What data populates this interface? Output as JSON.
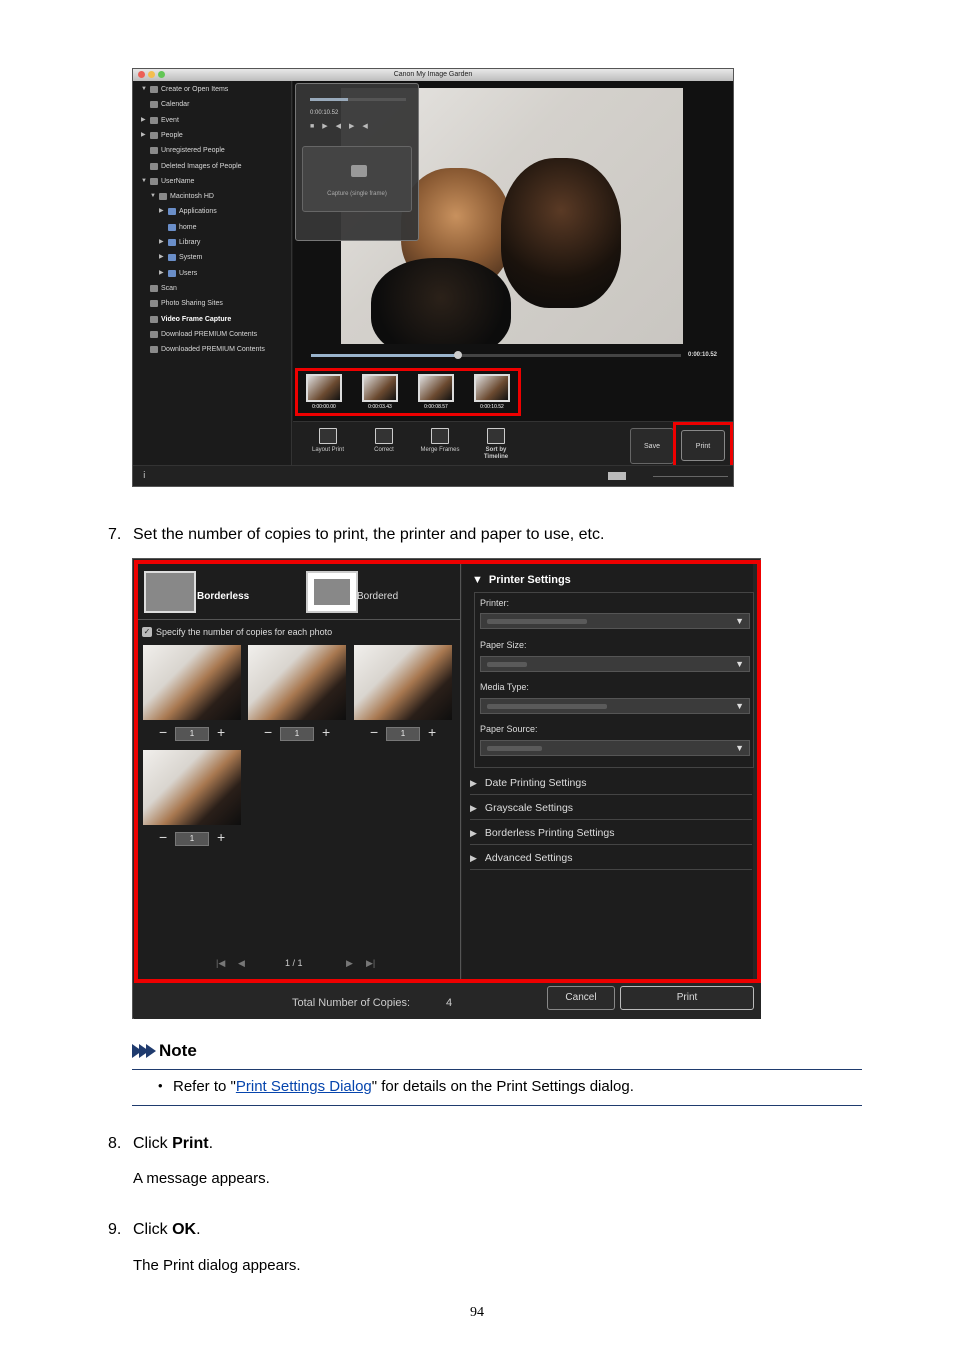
{
  "screenshot1": {
    "window_title": "Canon My Image Garden",
    "tree": [
      {
        "label": "Create or Open Items",
        "indent": 0,
        "arrow": "▼"
      },
      {
        "label": "Calendar",
        "indent": 0,
        "arrow": ""
      },
      {
        "label": "Event",
        "indent": 0,
        "arrow": "▶"
      },
      {
        "label": "People",
        "indent": 0,
        "arrow": "▶"
      },
      {
        "label": "Unregistered People",
        "indent": 0,
        "arrow": ""
      },
      {
        "label": "Deleted Images of People",
        "indent": 0,
        "arrow": ""
      },
      {
        "label": "UserName",
        "indent": 0,
        "arrow": "▼"
      },
      {
        "label": "Macintosh HD",
        "indent": 1,
        "arrow": "▼"
      },
      {
        "label": "Applications",
        "indent": 2,
        "arrow": "▶"
      },
      {
        "label": "home",
        "indent": 2,
        "arrow": ""
      },
      {
        "label": "Library",
        "indent": 2,
        "arrow": "▶"
      },
      {
        "label": "System",
        "indent": 2,
        "arrow": "▶"
      },
      {
        "label": "Users",
        "indent": 2,
        "arrow": "▶"
      },
      {
        "label": "Scan",
        "indent": 0,
        "arrow": ""
      },
      {
        "label": "Photo Sharing Sites",
        "indent": 0,
        "arrow": ""
      },
      {
        "label": "Video Frame Capture",
        "indent": 0,
        "arrow": "",
        "selected": true
      },
      {
        "label": "Download PREMIUM Contents",
        "indent": 0,
        "arrow": ""
      },
      {
        "label": "Downloaded PREMIUM Contents",
        "indent": 0,
        "arrow": ""
      }
    ],
    "player_time": "0:00:10.52",
    "capture_label": "Capture (single frame)",
    "seek_time": "0:00:10.52",
    "seek_progress": 0.39,
    "thumbnails": [
      "0:00:00.00",
      "0:00:03.43",
      "0:00:08.57",
      "0:00:10.52"
    ],
    "toolbar": [
      {
        "label": "Layout Print"
      },
      {
        "label": "Correct"
      },
      {
        "label": "Merge Frames"
      },
      {
        "label": "Sort by Timeline"
      }
    ],
    "save_label": "Save",
    "print_label": "Print"
  },
  "step7": {
    "num": "7.",
    "text": "Set the number of copies to print, the printer and paper to use, etc."
  },
  "screenshot2": {
    "borderless_label": "Borderless",
    "bordered_label": "Bordered",
    "specify_copies_label": "Specify the number of copies for each photo",
    "copies": [
      "1",
      "1",
      "1",
      "1"
    ],
    "pager": "1 / 1",
    "printer_settings_title": "Printer Settings",
    "fields": [
      {
        "label": "Printer:"
      },
      {
        "label": "Paper Size:"
      },
      {
        "label": "Media Type:"
      },
      {
        "label": "Paper Source:"
      }
    ],
    "sections": [
      "Date Printing Settings",
      "Grayscale Settings",
      "Borderless Printing Settings",
      "Advanced Settings"
    ],
    "total_label": "Total Number of Copies:",
    "total_value": "4",
    "cancel_label": "Cancel",
    "print_label": "Print"
  },
  "note": {
    "title": "Note",
    "bullet": "•",
    "text_before": "Refer to \"",
    "link_text": "Print Settings Dialog",
    "text_after": "\" for details on the Print Settings dialog."
  },
  "step8": {
    "num": "8.",
    "prefix": "Click ",
    "bold": "Print",
    "suffix": ".",
    "sub": "A message appears."
  },
  "step9": {
    "num": "9.",
    "prefix": "Click ",
    "bold": "OK",
    "suffix": ".",
    "sub": "The Print dialog appears."
  },
  "page_number": "94",
  "colors": {
    "highlight": "#e00000",
    "link": "#0645ad",
    "note_accent": "#1f3b6e"
  }
}
